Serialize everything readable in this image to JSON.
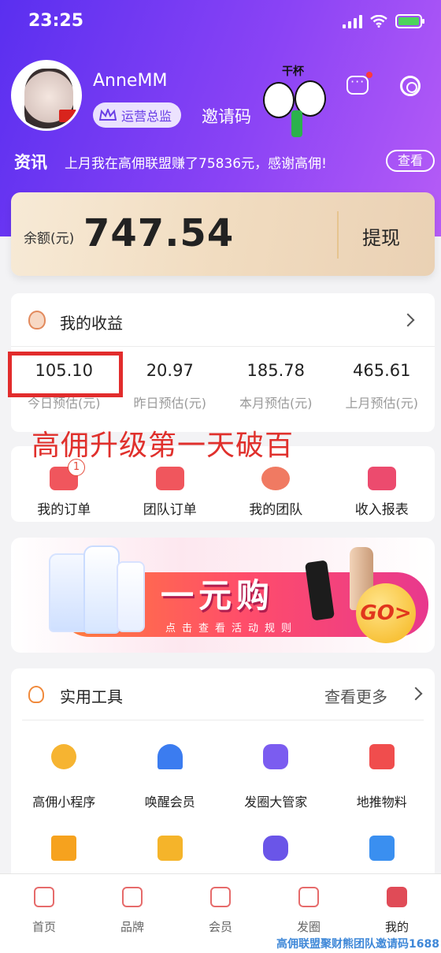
{
  "status_bar": {
    "time": "23:25",
    "icons": [
      "signal-icon",
      "wifi-icon",
      "battery-icon"
    ]
  },
  "profile": {
    "username": "AnneMM",
    "role": "运营总监",
    "invite_code_label": "邀请码",
    "sticker_text": "干杯"
  },
  "news": {
    "tag": "资讯",
    "text": "上月我在高佣联盟赚了75836元，感谢高佣!",
    "view_label": "查看"
  },
  "balance": {
    "label": "余额(元)",
    "amount": "747.54",
    "withdraw_label": "提现"
  },
  "earnings": {
    "title": "我的收益",
    "stats": [
      {
        "value": "105.10",
        "label": "今日预估(元)"
      },
      {
        "value": "20.97",
        "label": "昨日预估(元)"
      },
      {
        "value": "185.78",
        "label": "本月预估(元)"
      },
      {
        "value": "465.61",
        "label": "上月预估(元)"
      }
    ]
  },
  "annotation": "高佣升级第一天破百",
  "quick_actions": [
    {
      "label": "我的订单",
      "badge": "1"
    },
    {
      "label": "团队订单"
    },
    {
      "label": "我的团队"
    },
    {
      "label": "收入报表"
    }
  ],
  "banner": {
    "title": "一元购",
    "subtitle": "点击查看活动规则",
    "go": "GO>"
  },
  "tools": {
    "title": "实用工具",
    "more_label": "查看更多",
    "items": [
      {
        "label": "高佣小程序",
        "color": "#f6b431"
      },
      {
        "label": "唤醒会员",
        "color": "#3b7cf0"
      },
      {
        "label": "发圈大管家",
        "color": "#7b5cf0"
      },
      {
        "label": "地推物料",
        "color": "#f04d4d"
      },
      {
        "label": "",
        "color": "#f6a21e"
      },
      {
        "label": "",
        "color": "#f5b42a"
      },
      {
        "label": "",
        "color": "#6a55e8"
      },
      {
        "label": "",
        "color": "#3a8ff0"
      }
    ]
  },
  "tabbar": [
    {
      "label": "首页",
      "active": false
    },
    {
      "label": "品牌",
      "active": false
    },
    {
      "label": "会员",
      "active": false
    },
    {
      "label": "发圈",
      "active": false
    },
    {
      "label": "我的",
      "active": true
    }
  ],
  "watermark": "高佣联盟聚财熊团队邀请码1688",
  "colors": {
    "header_start": "#5a2ff0",
    "header_end": "#b65cf6",
    "accent_red": "#e0302c"
  }
}
